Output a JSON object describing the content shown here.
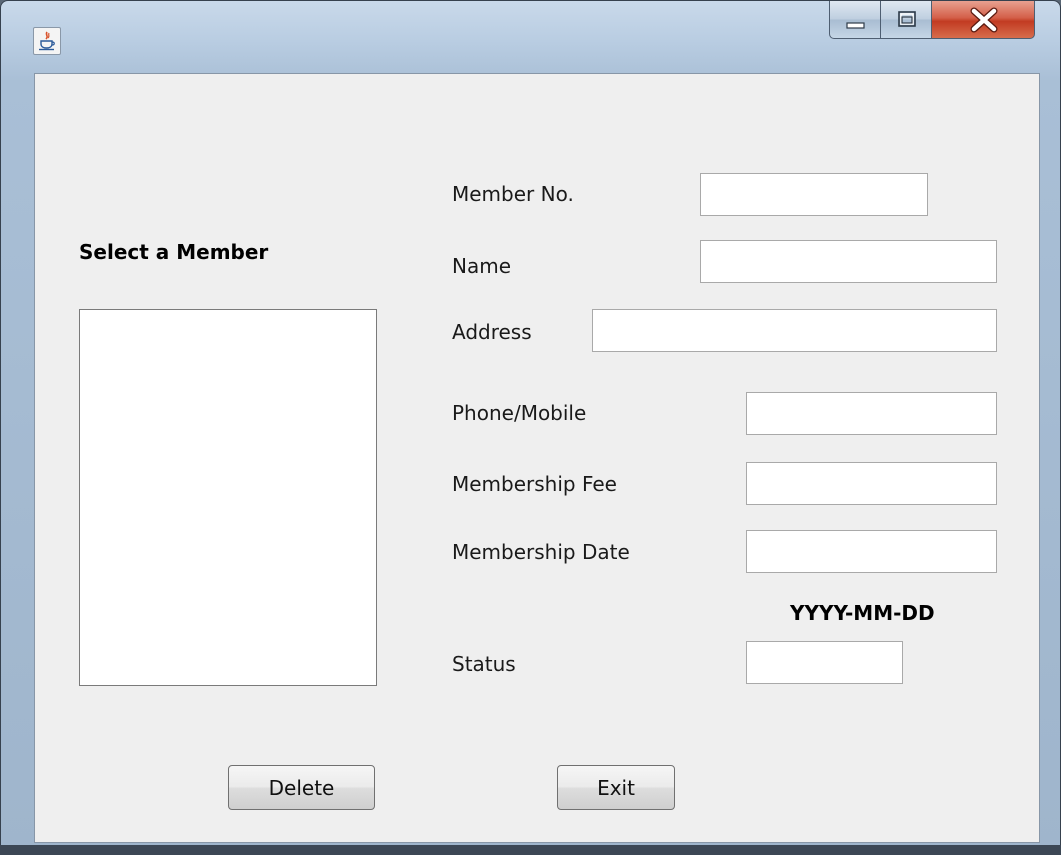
{
  "window": {
    "icon": "java-cup-icon",
    "controls": {
      "minimize": "minimize-icon",
      "maximize": "maximize-icon",
      "close": "close-icon"
    }
  },
  "member_list": {
    "heading": "Select a Member"
  },
  "form": {
    "member_no": {
      "label": "Member No.",
      "value": ""
    },
    "name": {
      "label": "Name",
      "value": ""
    },
    "address": {
      "label": "Address",
      "value": ""
    },
    "phone": {
      "label": "Phone/Mobile",
      "value": ""
    },
    "membership_fee": {
      "label": "Membership Fee",
      "value": ""
    },
    "membership_date": {
      "label": "Membership Date",
      "value": "",
      "format_hint": "YYYY-MM-DD"
    },
    "status": {
      "label": "Status",
      "value": ""
    }
  },
  "buttons": {
    "delete": "Delete",
    "exit": "Exit"
  },
  "colors": {
    "close_button": "#c23b22",
    "client_background": "#efefef"
  }
}
